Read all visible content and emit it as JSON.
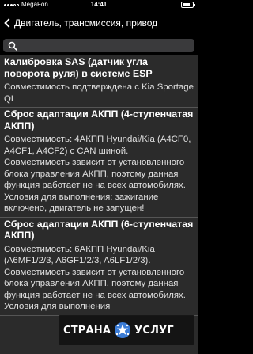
{
  "status_bar": {
    "carrier": "MegaFon",
    "time": "14:41"
  },
  "nav": {
    "title": "Двигатель, трансмиссия, привод"
  },
  "search": {
    "placeholder": "",
    "value": ""
  },
  "items": [
    {
      "title": "Калибровка SAS (датчик угла поворота руля) в системе ESP",
      "description": "Совместимость подтверждена с Kia Sportage QL"
    },
    {
      "title": "Сброс адаптации АКПП (4-ступенчатая АКПП)",
      "description": "Совместимость: 4АКПП Hyundai/Kia (A4CF0, A4CF1, A4CF2) с CAN шиной. Совместимость зависит от установленного блока управления АКПП, поэтому данная функция работает не на всех автомобилях. Условия для выполнения: зажигание включено, двигатель не запущен!"
    },
    {
      "title": "Сброс адаптации АКПП (6-ступенчатая АКПП)",
      "description": "Совместимость: 6АКПП Hyundai/Kia (A6MF1/2/3, A6GF1/2/3, A6LF1/2/3). Совместимость зависит от установленного блока управления АКПП, поэтому данная функция работает не на всех автомобилях. Условия для выполнения"
    }
  ],
  "watermark": {
    "left_text": "СТРАНА",
    "right_text": "УСЛУГ",
    "logo_color": "#3a7bd5"
  }
}
